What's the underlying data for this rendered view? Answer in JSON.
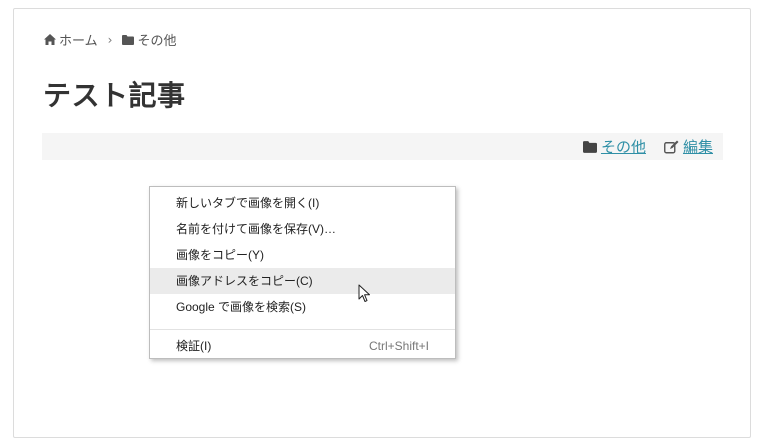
{
  "breadcrumb": {
    "home_label": "ホーム",
    "separator": "›",
    "category_label": "その他",
    "home_icon": "home-icon",
    "folder_icon": "folder-icon"
  },
  "article": {
    "title": "テスト記事"
  },
  "meta": {
    "category_link": "その他",
    "edit_link": "編集",
    "category_icon": "folder-icon",
    "edit_icon": "edit-icon",
    "link_color": "#2f8fa6"
  },
  "context_menu": {
    "items": [
      {
        "label": "新しいタブで画像を開く(I)",
        "shortcut": ""
      },
      {
        "label": "名前を付けて画像を保存(V)…",
        "shortcut": ""
      },
      {
        "label": "画像をコピー(Y)",
        "shortcut": ""
      },
      {
        "label": "画像アドレスをコピー(C)",
        "shortcut": "",
        "hovered": true
      },
      {
        "label": "Google で画像を検索(S)",
        "shortcut": ""
      },
      {
        "label": "検証(I)",
        "shortcut": "Ctrl+Shift+I"
      }
    ]
  }
}
